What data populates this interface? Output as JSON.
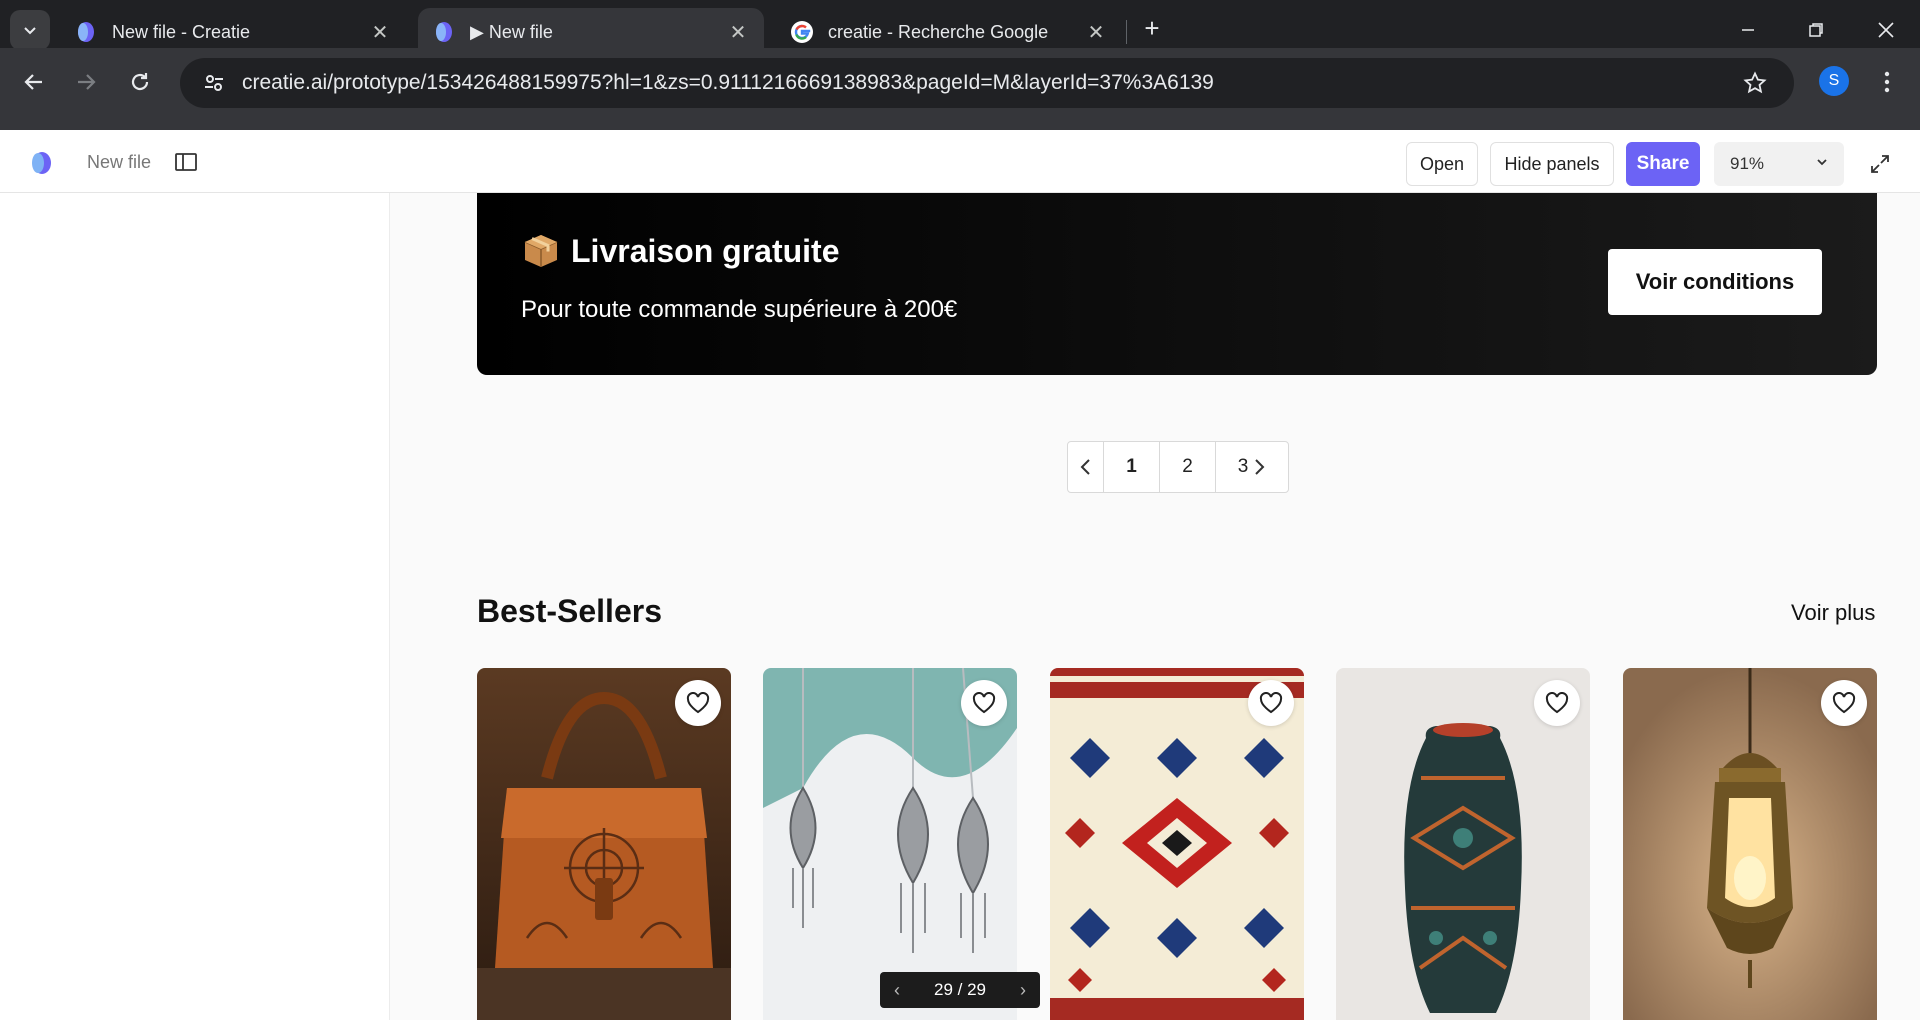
{
  "browser": {
    "tabs": [
      {
        "title": "New file - Creatie"
      },
      {
        "title": "▶ New file"
      },
      {
        "title": "creatie - Recherche Google"
      }
    ],
    "url": "creatie.ai/prototype/153426488159975?hl=1&zs=0.9111216669138983&pageId=M&layerId=37%3A6139",
    "profile_initial": "S"
  },
  "app": {
    "file_name": "New file",
    "open_label": "Open",
    "hide_panels_label": "Hide panels",
    "share_label": "Share",
    "zoom": "91%",
    "accent": "#6c63f5"
  },
  "promo": {
    "title": "Livraison gratuite",
    "subtitle": "Pour toute commande supérieure à 200€",
    "button": "Voir conditions"
  },
  "pagination": {
    "pages": [
      "1",
      "2",
      "3"
    ],
    "current": "1"
  },
  "best_sellers": {
    "title": "Best-Sellers",
    "see_more": "Voir plus",
    "products": [
      {
        "image": "leather-bag"
      },
      {
        "image": "silver-earrings"
      },
      {
        "image": "berber-rug"
      },
      {
        "image": "ceramic-vase"
      },
      {
        "image": "brass-lantern"
      }
    ]
  },
  "prototype_nav": {
    "counter": "29 / 29"
  }
}
